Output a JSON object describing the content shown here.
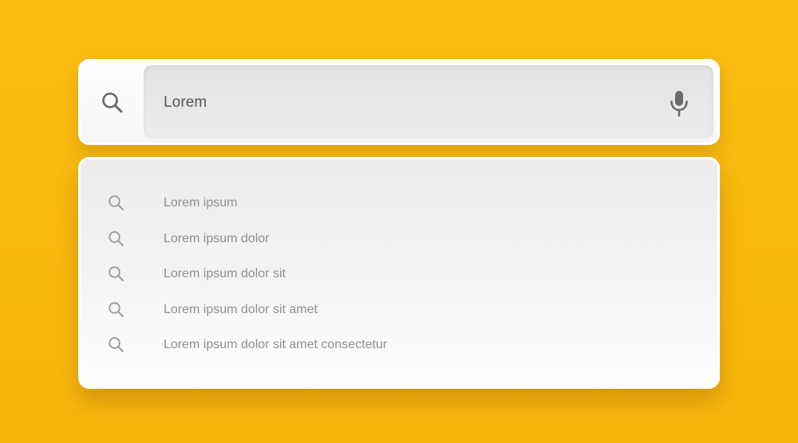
{
  "search": {
    "query": "Lorem",
    "leading_icon": "search-icon",
    "trailing_icon": "microphone-icon"
  },
  "suggestions": [
    {
      "label": "Lorem ipsum",
      "icon": "search-icon"
    },
    {
      "label": "Lorem ipsum dolor",
      "icon": "search-icon"
    },
    {
      "label": "Lorem ipsum dolor sit",
      "icon": "search-icon"
    },
    {
      "label": "Lorem ipsum dolor sit amet",
      "icon": "search-icon"
    },
    {
      "label": "Lorem ipsum dolor sit amet consectetur",
      "icon": "search-icon"
    }
  ],
  "colors": {
    "background": "#fbbd12",
    "panel": "#f4f4f4",
    "field": "#e6e6e6",
    "text_primary": "#555555",
    "text_secondary": "#8f8f8f",
    "icon": "#6b6b6b"
  }
}
